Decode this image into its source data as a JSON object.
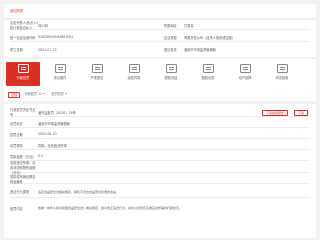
{
  "topbar": {
    "link": "返回列表"
  },
  "info": {
    "rows": [
      {
        "label": "法定代表人/负责人/执行事务合伙人",
        "value": "刘小明",
        "label2": "所属地区",
        "value2": "甘肃省"
      },
      {
        "label": "统一社会信用代码",
        "value": "9162092JYHK8B1J5X4",
        "label2": "企业类型",
        "value2": "有限责任公司（自然人投资或控股）"
      },
      {
        "label": "成立日期",
        "value": "2021-07-23",
        "label2": "登记机关",
        "value2": "酒泉市市场监督管理局"
      }
    ]
  },
  "tabs": [
    {
      "label": "行政处罚",
      "active": true
    },
    {
      "label": "诉讼案件",
      "active": false
    },
    {
      "label": "严重违法",
      "active": false
    },
    {
      "label": "经营异常",
      "active": false
    },
    {
      "label": "股权冻结",
      "active": false
    },
    {
      "label": "股权出质",
      "active": false
    },
    {
      "label": "动产抵押",
      "active": false
    },
    {
      "label": "司法拍卖",
      "active": false
    }
  ],
  "filter": {
    "chip": "全部",
    "options": [
      {
        "label": "行政处罚",
        "count": "12"
      },
      {
        "label": "处罚机关"
      }
    ]
  },
  "detail": {
    "doc_number_label": "行政处罚决定书文号",
    "doc_number_value": "酒市监处罚〔2020〕76号",
    "download_label": "下载信用报告",
    "download_label2": "下载",
    "rows": [
      {
        "label": "处罚机关",
        "value": "酒泉市市场监督管理局"
      },
      {
        "label": "处罚日期",
        "value": "2020-06-30"
      },
      {
        "label": "处罚类别",
        "value": "罚款；没收违法所得"
      },
      {
        "label": "罚款金额（万元）",
        "value": "0.5"
      },
      {
        "label": "没收违法所得、没收非法财物的金额（万元）",
        "value": ""
      },
      {
        "label": "暂扣或吊销证照名称及编号",
        "value": ""
      },
      {
        "label": "违法行为类型",
        "value": "违反食品安全法相关规定，销售不符合食品安全标准的食品"
      },
      {
        "label": "处罚内容",
        "value": "依据《中华人民共和国食品安全法》相关规定，责令改正违法行为，并处以罚款及没收违法所得的行政处罚。"
      }
    ]
  }
}
